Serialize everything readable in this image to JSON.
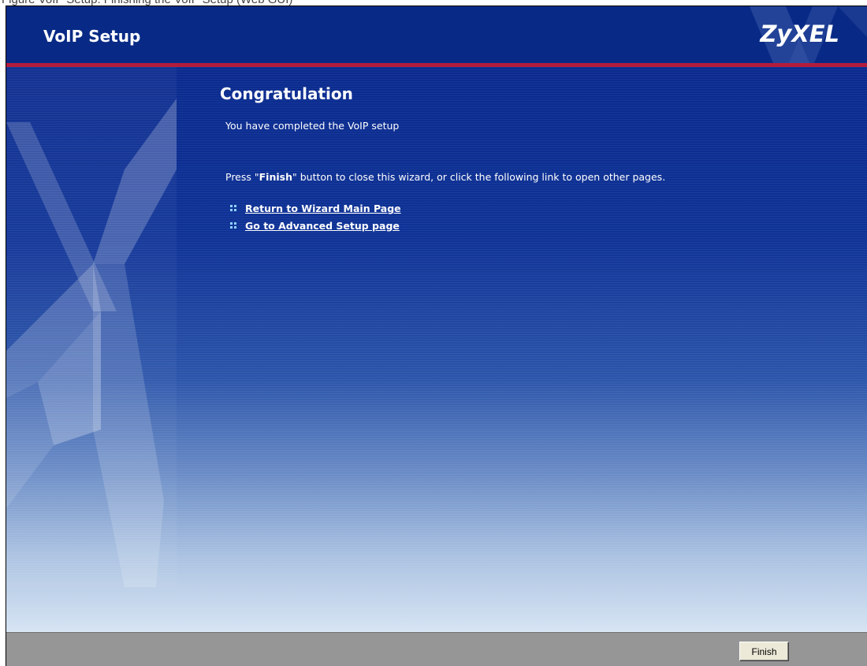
{
  "caption": "Figure    VoIP Setup: Finishing the VoIP Setup (Web GUI)",
  "header": {
    "title": "VoIP Setup",
    "brand": "ZyXEL"
  },
  "content": {
    "heading": "Congratulation",
    "completed_text": "You have completed the VoIP setup",
    "instruction_prefix": "Press \"",
    "instruction_bold": "Finish",
    "instruction_suffix": "\" button to close this wizard, or click the following link to open other pages.",
    "links": [
      {
        "label": "Return to Wizard Main Page"
      },
      {
        "label": "Go to Advanced Setup page"
      }
    ]
  },
  "footer": {
    "finish_label": "Finish"
  },
  "colors": {
    "header_bg": "#082a86",
    "accent_line": "#b31c3c",
    "footer_bg": "#969696"
  }
}
